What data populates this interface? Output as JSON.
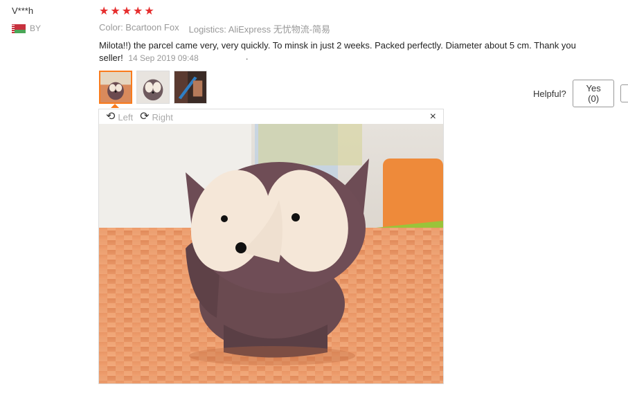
{
  "review": {
    "user_name": "V***h",
    "country": "BY",
    "rating": 5,
    "color_text": "Color: Bcartoon Fox",
    "logistics_text": "Logistics: AliExpress 无忧物流-简易",
    "body": "Milota!!) the parcel came very, very quickly. To minsk in just 2 weeks. Packed perfectly. Diameter about 5 cm. Thank you seller!",
    "date": "14 Sep 2019 09:48",
    "trailing_mark": "."
  },
  "helpful": {
    "label": "Helpful?",
    "yes_label": "Yes (0)"
  },
  "viewer": {
    "left_label": "Left",
    "right_label": "Right",
    "close_symbol": "×"
  },
  "colors": {
    "star": "#e62e2e",
    "active_thumb": "#f97b1c",
    "meta_gray": "#999999"
  }
}
